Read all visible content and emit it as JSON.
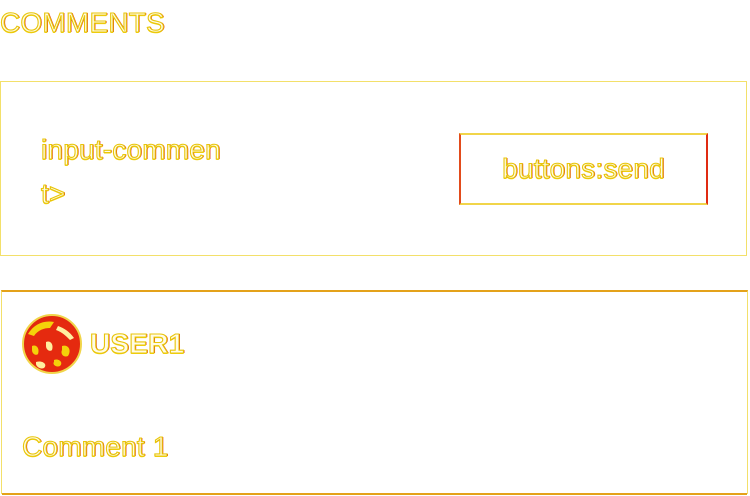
{
  "page": {
    "title": "COMMENTS"
  },
  "compose": {
    "input_value": "input-comment>",
    "send_label": "buttons:send"
  },
  "comments": [
    {
      "user": "USER1",
      "text": "Comment 1",
      "avatar_icon": "user-avatar-icon"
    }
  ],
  "colors": {
    "text_outline": "#e8c60a",
    "accent_red": "#e02b12",
    "border": "#f3e06a"
  }
}
